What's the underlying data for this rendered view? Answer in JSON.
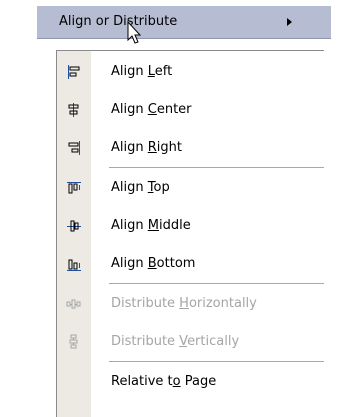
{
  "parent_menu": {
    "label": "Align or Distribute"
  },
  "submenu": {
    "items": [
      {
        "label": "Align Left",
        "mnemonic": "L",
        "icon": "align-left-icon",
        "enabled": true
      },
      {
        "label": "Align Center",
        "mnemonic": "C",
        "icon": "align-center-icon",
        "enabled": true
      },
      {
        "label": "Align Right",
        "mnemonic": "R",
        "icon": "align-right-icon",
        "enabled": true
      },
      {
        "label": "Align Top",
        "mnemonic": "T",
        "icon": "align-top-icon",
        "enabled": true
      },
      {
        "label": "Align Middle",
        "mnemonic": "M",
        "icon": "align-middle-icon",
        "enabled": true
      },
      {
        "label": "Align Bottom",
        "mnemonic": "B",
        "icon": "align-bottom-icon",
        "enabled": true
      },
      {
        "label": "Distribute Horizontally",
        "mnemonic": "H",
        "icon": "distribute-horizontally-icon",
        "enabled": false
      },
      {
        "label": "Distribute Vertically",
        "mnemonic": "V",
        "icon": "distribute-vertically-icon",
        "enabled": false
      },
      {
        "label": "Relative to Page",
        "mnemonic": "o",
        "enabled": true
      }
    ]
  },
  "colors": {
    "highlight": "#b6bdd2",
    "gutter": "#eceae3",
    "disabled_text": "#a5a5a5",
    "icon_blue": "#1f4ea3"
  }
}
